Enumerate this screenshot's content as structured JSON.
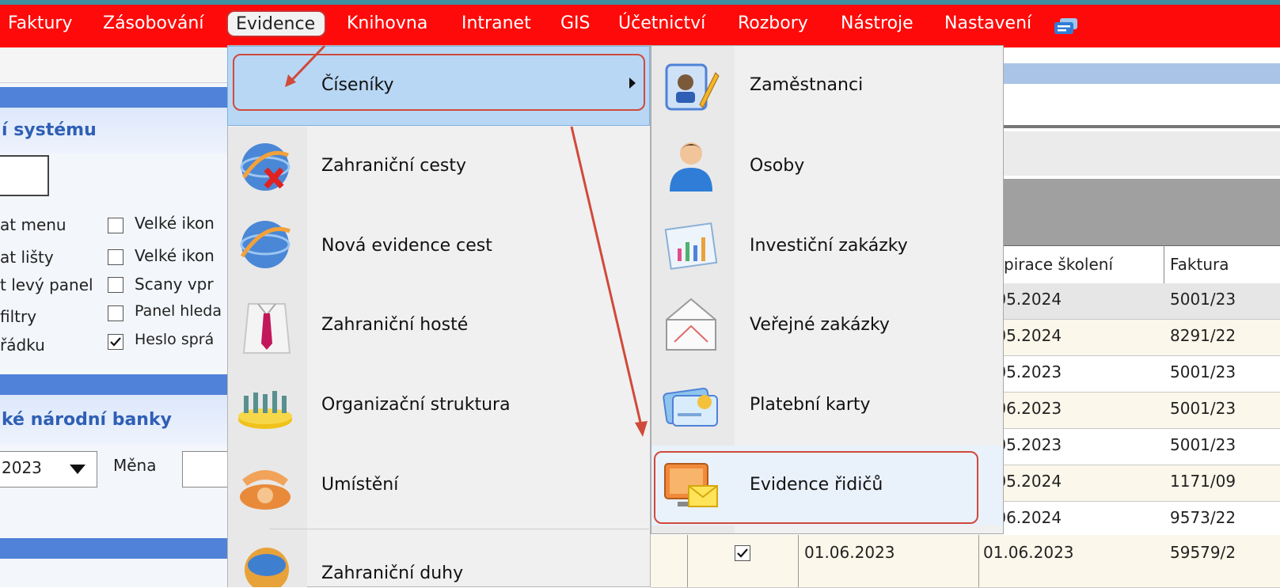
{
  "menubar": {
    "items": [
      "Faktury",
      "Zásobování",
      "Evidence",
      "Knihovna",
      "Intranet",
      "GIS",
      "Účetnictví",
      "Rozbory",
      "Nástroje",
      "Nastavení"
    ],
    "chat_icon": "chat-bubbles-icon"
  },
  "left_panel": {
    "section_title": "í systému",
    "options_left": [
      "at menu",
      "at lišty",
      "t levý panel",
      "filtry",
      "řádku"
    ],
    "options_right": [
      "Velké ikon",
      "Velké ikon",
      "Scany vpr",
      "Panel hleda",
      "Heslo sprá"
    ],
    "bank_title": "ké národní banky",
    "year_value": "2023",
    "currency_label": "Měna"
  },
  "evidence_menu": {
    "items": [
      {
        "label": "Číseníky",
        "icon": "none",
        "has_submenu": true
      },
      {
        "label": "Zahraniční cesty",
        "icon": "globe-cross-icon"
      },
      {
        "label": "Nová evidence cest",
        "icon": "globe-icon"
      },
      {
        "label": "Zahraniční hosté",
        "icon": "shirt-tie-icon"
      },
      {
        "label": "Organizační struktura",
        "icon": "people-group-icon"
      },
      {
        "label": "Umístění",
        "icon": "telephone-icon"
      },
      {
        "label": "Zahraniční duhy",
        "icon": "globe-folder-icon"
      }
    ]
  },
  "ciseniky_submenu": {
    "items": [
      {
        "label": "Zaměstnanci",
        "icon": "employee-card-icon"
      },
      {
        "label": "Osoby",
        "icon": "person-icon"
      },
      {
        "label": "Investiční zakázky",
        "icon": "investment-chart-icon"
      },
      {
        "label": "Veřejné zakázky",
        "icon": "envelope-icon"
      },
      {
        "label": "Platební karty",
        "icon": "payment-card-icon"
      },
      {
        "label": "Evidence řidičů",
        "icon": "monitor-mail-icon"
      }
    ]
  },
  "table": {
    "headers": [
      "pirace školení",
      "Faktura"
    ],
    "rows": [
      {
        "expirace": ".05.2024",
        "faktura": "5001/23"
      },
      {
        "expirace": ".05.2024",
        "faktura": "8291/22"
      },
      {
        "expirace": ".05.2023",
        "faktura": "5001/23"
      },
      {
        "expirace": ".06.2023",
        "faktura": "5001/23"
      },
      {
        "expirace": ".05.2023",
        "faktura": "5001/23"
      },
      {
        "expirace": ".05.2024",
        "faktura": "1171/09"
      },
      {
        "expirace": ".06.2024",
        "faktura": "9573/22"
      },
      {
        "date1": "01.06.2023",
        "expirace": "01.06.2023",
        "faktura": "59579/2"
      }
    ]
  },
  "colors": {
    "menubar": "#ff0a0a",
    "highlight": "#b8d7f5",
    "annotation": "#cf4a3a",
    "panel_header": "#4f82d8"
  }
}
